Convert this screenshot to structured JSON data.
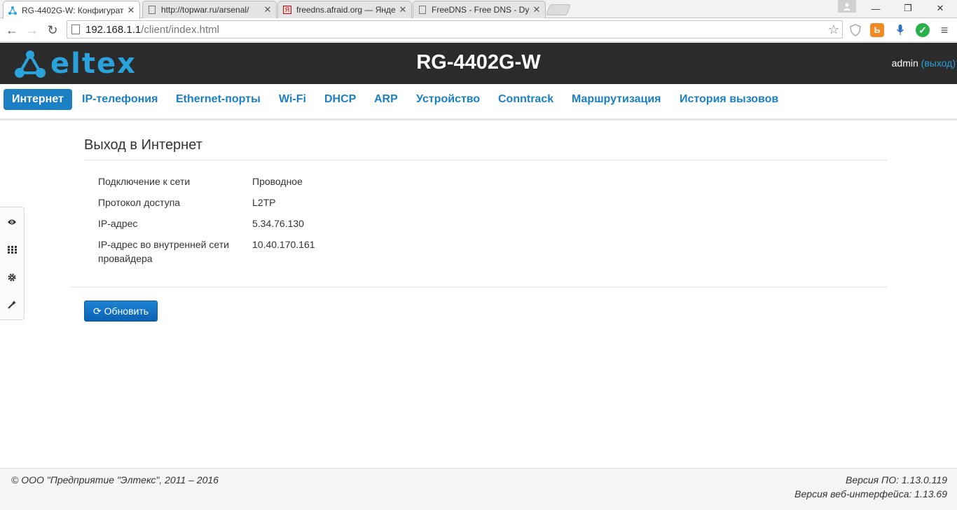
{
  "browser": {
    "tabs": [
      {
        "title": "RG-4402G-W: Конфигурат",
        "favicon": "eltex-icon"
      },
      {
        "title": "http://topwar.ru/arsenal/",
        "favicon": "page-icon"
      },
      {
        "title": "freedns.afraid.org — Янде",
        "favicon": "yandex-icon"
      },
      {
        "title": "FreeDNS - Free DNS - Dyn",
        "favicon": "page-icon"
      }
    ],
    "url_host": "192.168.1.1",
    "url_path": "/client/index.html"
  },
  "header": {
    "logo_text": "eltex",
    "device_title": "RG-4402G-W",
    "user": "admin",
    "logout_label": "(выход)"
  },
  "nav": {
    "items": [
      {
        "label": "Интернет",
        "active": true
      },
      {
        "label": "IP-телефония"
      },
      {
        "label": "Ethernet-порты"
      },
      {
        "label": "Wi-Fi"
      },
      {
        "label": "DHCP"
      },
      {
        "label": "ARP"
      },
      {
        "label": "Устройство"
      },
      {
        "label": "Conntrack"
      },
      {
        "label": "Маршрутизация"
      },
      {
        "label": "История вызовов"
      }
    ]
  },
  "sidebar": {
    "icons": [
      "eye-icon",
      "grid-icon",
      "gear-icon",
      "wand-icon"
    ]
  },
  "main": {
    "section_title": "Выход в Интернет",
    "rows": [
      {
        "label": "Подключение к сети",
        "value": "Проводное"
      },
      {
        "label": "Протокол доступа",
        "value": "L2TP"
      },
      {
        "label": "IP-адрес",
        "value": "5.34.76.130"
      },
      {
        "label": "IP-адрес во внутренней сети провайдера",
        "value": "10.40.170.161"
      }
    ],
    "refresh_label": "Обновить"
  },
  "footer": {
    "copyright": "© ООО \"Предприятие \"Элтекс\", 2011 – 2016",
    "firmware_version": "Версия ПО: 1.13.0.119",
    "web_version": "Версия веб-интерфейса: 1.13.69"
  },
  "colors": {
    "accent": "#1b7fc4",
    "header_bg": "#2b2b2b",
    "logo": "#2aa3dc"
  }
}
